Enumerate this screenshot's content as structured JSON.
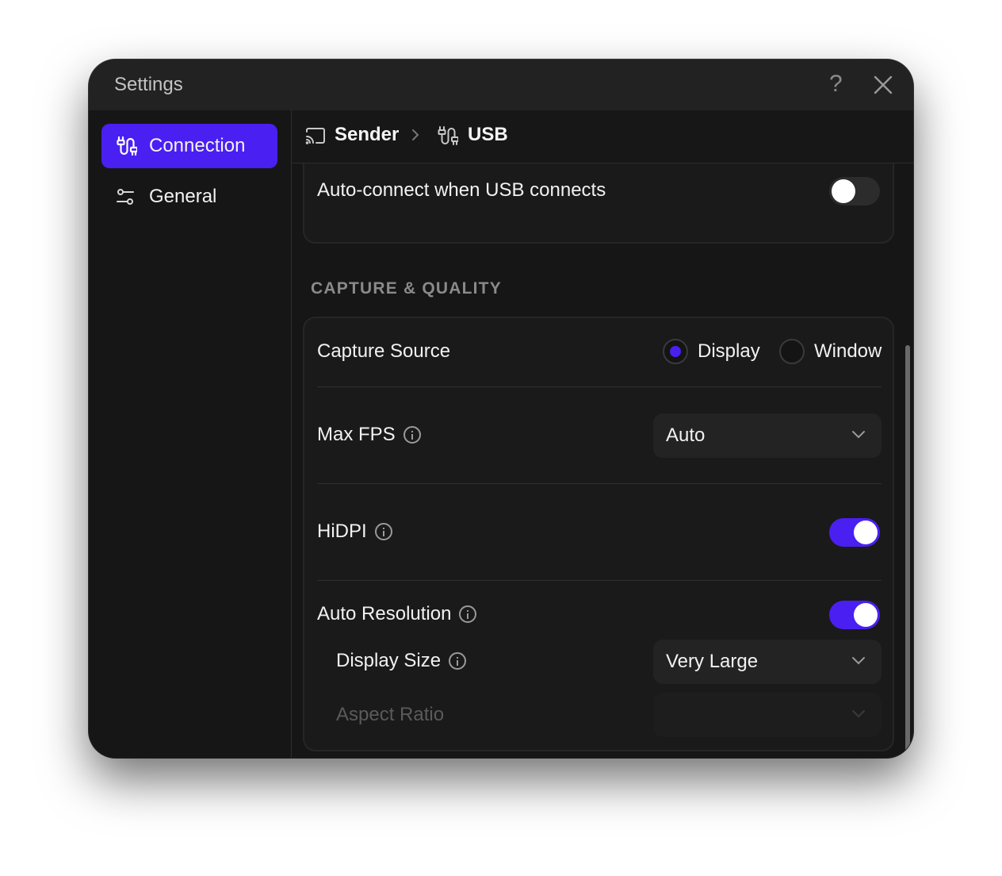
{
  "window": {
    "title": "Settings"
  },
  "sidebar": {
    "items": [
      {
        "label": "Connection",
        "active": true,
        "icon": "usb-cable-icon"
      },
      {
        "label": "General",
        "active": false,
        "icon": "sliders-icon"
      }
    ]
  },
  "breadcrumb": {
    "items": [
      {
        "label": "Sender",
        "icon": "cast-icon"
      },
      {
        "label": "USB",
        "icon": "usb-cable-icon"
      }
    ]
  },
  "connection_card": {
    "auto_connect": {
      "label": "Auto-connect when USB connects",
      "enabled": false
    }
  },
  "capture_quality": {
    "heading": "CAPTURE & QUALITY",
    "capture_source": {
      "label": "Capture Source",
      "options": [
        {
          "label": "Display",
          "selected": true
        },
        {
          "label": "Window",
          "selected": false
        }
      ]
    },
    "max_fps": {
      "label": "Max FPS",
      "value": "Auto"
    },
    "hidpi": {
      "label": "HiDPI",
      "enabled": true
    },
    "auto_resolution": {
      "label": "Auto Resolution",
      "enabled": true
    },
    "display_size": {
      "label": "Display Size",
      "value": "Very Large"
    },
    "aspect_ratio": {
      "label": "Aspect Ratio",
      "value": "",
      "disabled": true
    }
  },
  "colors": {
    "accent": "#4a1ff2",
    "background": "#161616",
    "titlebar": "#222222"
  }
}
